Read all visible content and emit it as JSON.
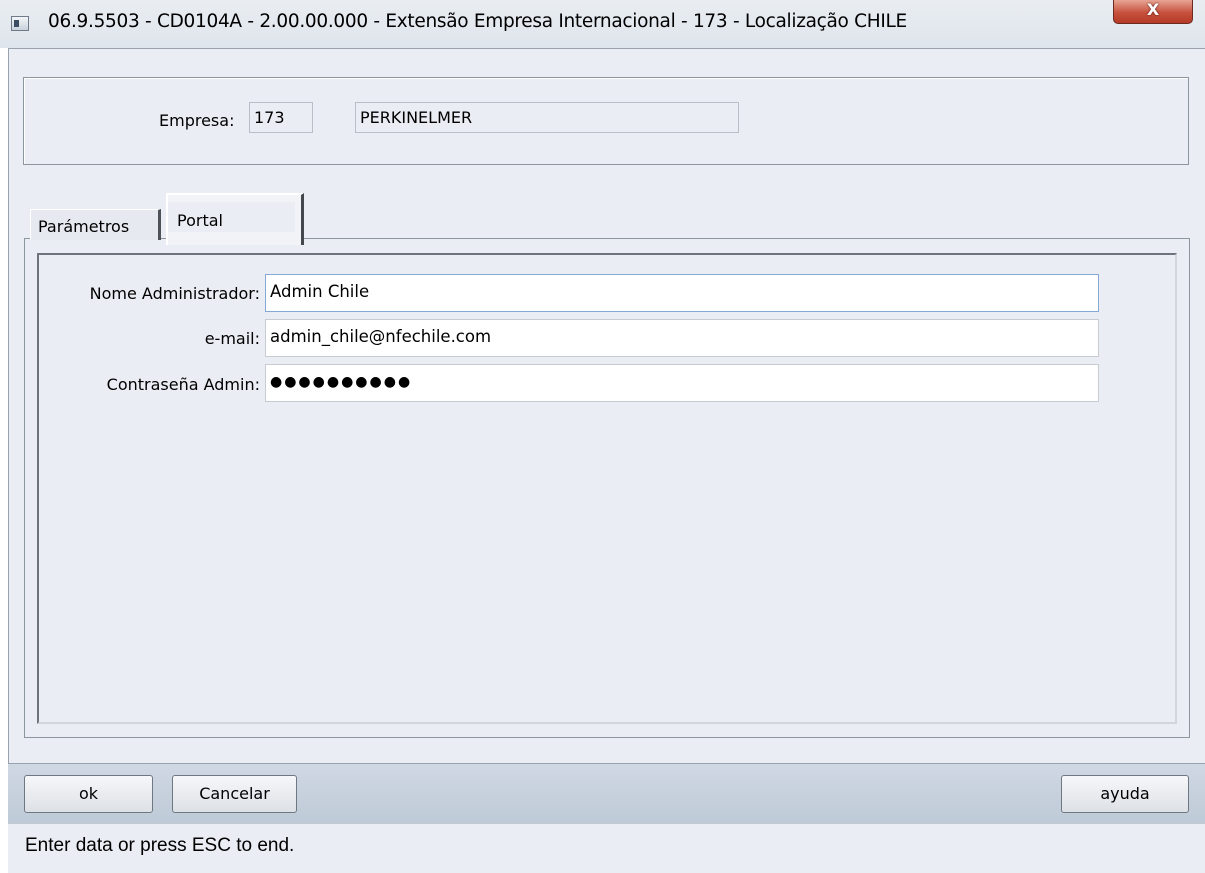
{
  "window": {
    "title": "06.9.5503 - CD0104A - 2.00.00.000 - Extensão Empresa Internacional - 173 - Localização CHILE",
    "close_glyph": "X",
    "icon": "app-window-icon"
  },
  "empresa": {
    "label": "Empresa:",
    "code": "173",
    "name": "PERKINELMER"
  },
  "tabs": [
    {
      "label": "Parámetros",
      "active": false
    },
    {
      "label": "Portal",
      "active": true
    }
  ],
  "portal": {
    "nome_admin_label": "Nome Administrador:",
    "nome_admin_value": "Admin Chile",
    "email_label": "e-mail:",
    "email_value": "admin_chile@nfechile.com",
    "senha_label": "Contraseña Admin:",
    "senha_value": "●●●●●●●●●●"
  },
  "buttons": {
    "ok": "ok",
    "cancel": "Cancelar",
    "help": "ayuda"
  },
  "status": {
    "text": "Enter data or press ESC to end."
  }
}
